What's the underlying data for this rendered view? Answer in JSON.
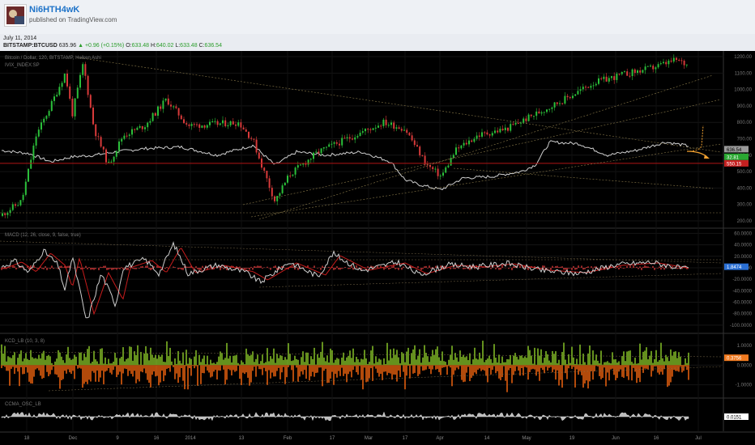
{
  "header": {
    "author": "Ni6HTH4wK",
    "published": "published on TradingView.com",
    "avatar_icon": "user-avatar-icon"
  },
  "date": "July 11, 2014",
  "quote": {
    "symbol": "BITSTAMP:BTCUSD",
    "last": "635.96",
    "change": "▲ +0.96 (+0.15%)",
    "open_label": "O:",
    "open": "633.48",
    "high_label": "H:",
    "high": "640.02",
    "low_label": "L:",
    "low": "633.48",
    "close_label": "C:",
    "close": "636.54"
  },
  "colors": {
    "background": "#000000",
    "candle_up": "#2bbf3a",
    "candle_down": "#d83a3a",
    "line_gray": "#cfcfcf",
    "support_red": "#b01414",
    "hist_green": "#8fcf2a",
    "hist_orange": "#ff6a10",
    "arrow_orange": "#f0a030"
  },
  "chart_data": [
    {
      "type": "candlestick",
      "title": "Bitcoin / Dollar, 120, BITSTAMP, Heiken Ashi",
      "overlay": "IVIX_INDEX:SP",
      "yticks": [
        "1200.00",
        "1100.00",
        "1000.00",
        "900.00",
        "800.00",
        "700.00",
        "600.00",
        "500.00",
        "400.00",
        "300.00",
        "200.00"
      ],
      "ylim": [
        180,
        1215
      ],
      "price_labels": {
        "last": "636.54",
        "secondary": "32.81",
        "support": "550.15"
      },
      "support_level": 550.15,
      "xticks": [
        "18",
        "Dec",
        "9",
        "16",
        "2014",
        "13",
        "Feb",
        "17",
        "Mar",
        "17",
        "Apr",
        "14",
        "May",
        "19",
        "Jun",
        "16",
        "Jul"
      ],
      "price_anchors": [
        [
          0,
          230
        ],
        [
          0.03,
          320
        ],
        [
          0.05,
          720
        ],
        [
          0.07,
          900
        ],
        [
          0.09,
          1100
        ],
        [
          0.1,
          850
        ],
        [
          0.115,
          1160
        ],
        [
          0.13,
          760
        ],
        [
          0.15,
          540
        ],
        [
          0.17,
          720
        ],
        [
          0.2,
          780
        ],
        [
          0.23,
          940
        ],
        [
          0.26,
          780
        ],
        [
          0.3,
          790
        ],
        [
          0.33,
          800
        ],
        [
          0.35,
          690
        ],
        [
          0.36,
          560
        ],
        [
          0.38,
          320
        ],
        [
          0.4,
          480
        ],
        [
          0.44,
          620
        ],
        [
          0.48,
          700
        ],
        [
          0.5,
          740
        ],
        [
          0.53,
          800
        ],
        [
          0.56,
          760
        ],
        [
          0.59,
          540
        ],
        [
          0.61,
          470
        ],
        [
          0.63,
          630
        ],
        [
          0.66,
          720
        ],
        [
          0.7,
          760
        ],
        [
          0.74,
          850
        ],
        [
          0.78,
          940
        ],
        [
          0.82,
          1040
        ],
        [
          0.86,
          1090
        ],
        [
          0.9,
          1130
        ],
        [
          0.935,
          1180
        ],
        [
          0.965,
          1120
        ]
      ],
      "ivix_anchors": [
        [
          0,
          630
        ],
        [
          0.04,
          610
        ],
        [
          0.07,
          560
        ],
        [
          0.1,
          590
        ],
        [
          0.13,
          600
        ],
        [
          0.16,
          620
        ],
        [
          0.2,
          640
        ],
        [
          0.25,
          650
        ],
        [
          0.3,
          600
        ],
        [
          0.35,
          660
        ],
        [
          0.38,
          540
        ],
        [
          0.41,
          620
        ],
        [
          0.45,
          600
        ],
        [
          0.5,
          620
        ],
        [
          0.54,
          560
        ],
        [
          0.56,
          450
        ],
        [
          0.58,
          420
        ],
        [
          0.61,
          390
        ],
        [
          0.64,
          460
        ],
        [
          0.68,
          470
        ],
        [
          0.72,
          500
        ],
        [
          0.74,
          540
        ],
        [
          0.76,
          680
        ],
        [
          0.8,
          670
        ],
        [
          0.84,
          600
        ],
        [
          0.88,
          630
        ],
        [
          0.92,
          680
        ],
        [
          0.96,
          650
        ],
        [
          0.98,
          640
        ]
      ],
      "projection_labels": "orange forecast arrows"
    },
    {
      "type": "line",
      "title": "MACD (12, 26, close, 9, false, true)",
      "yticks": [
        "60.0000",
        "40.0000",
        "20.0000",
        "0.0000",
        "-20.0000",
        "-40.0000",
        "-60.0000",
        "-80.0000",
        "-100.0000"
      ],
      "ylim": [
        -110,
        62
      ],
      "value_label": "1.8474",
      "macd_anchors": [
        [
          0,
          0
        ],
        [
          0.02,
          12
        ],
        [
          0.04,
          -8
        ],
        [
          0.06,
          30
        ],
        [
          0.08,
          5
        ],
        [
          0.09,
          -40
        ],
        [
          0.1,
          20
        ],
        [
          0.12,
          -95
        ],
        [
          0.14,
          -10
        ],
        [
          0.16,
          -65
        ],
        [
          0.17,
          0
        ],
        [
          0.2,
          15
        ],
        [
          0.22,
          -10
        ],
        [
          0.24,
          42
        ],
        [
          0.26,
          -10
        ],
        [
          0.3,
          5
        ],
        [
          0.34,
          -8
        ],
        [
          0.36,
          -25
        ],
        [
          0.4,
          10
        ],
        [
          0.44,
          -15
        ],
        [
          0.46,
          25
        ],
        [
          0.5,
          -5
        ],
        [
          0.55,
          10
        ],
        [
          0.58,
          -12
        ],
        [
          0.62,
          5
        ],
        [
          0.66,
          2
        ],
        [
          0.7,
          8
        ],
        [
          0.75,
          -5
        ],
        [
          0.8,
          -10
        ],
        [
          0.85,
          5
        ],
        [
          0.9,
          10
        ],
        [
          0.95,
          -3
        ],
        [
          0.98,
          3
        ]
      ]
    },
    {
      "type": "bar",
      "title": "KCD_LB (10, 3, 8)",
      "yticks": [
        "1.0000",
        "0.3756",
        "0.0000",
        "-1.0000"
      ],
      "ylim": [
        -1.55,
        1.45
      ],
      "value_label": "0.3756"
    },
    {
      "type": "area",
      "title": "CCMA_OSC_LB",
      "value_label": "0.0151"
    }
  ]
}
